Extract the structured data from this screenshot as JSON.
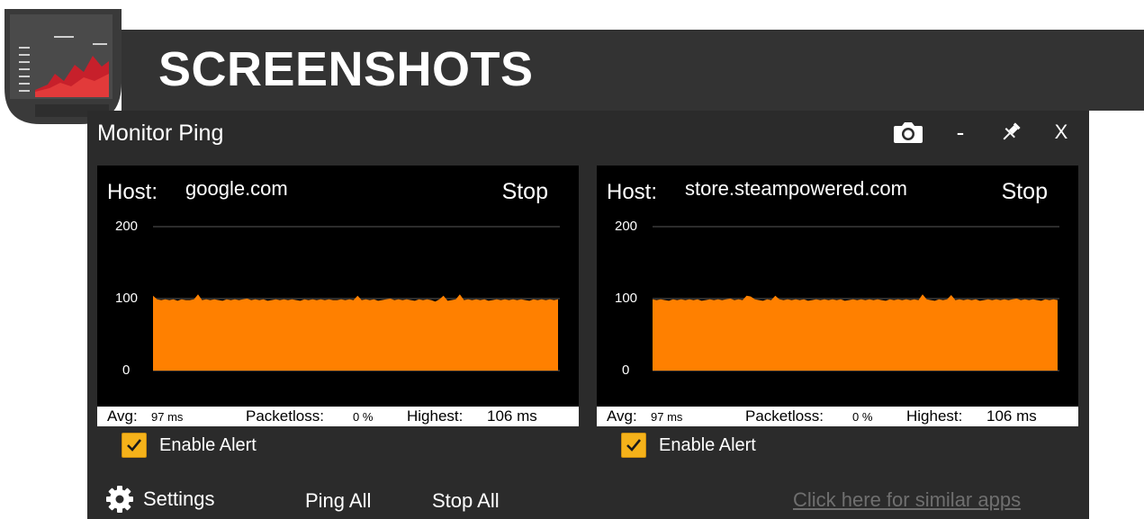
{
  "banner": {
    "title": "SCREENSHOTS",
    "logo_icon": "chart-logo-icon"
  },
  "window": {
    "title": "Monitor Ping",
    "buttons": {
      "screenshot_icon": "camera-icon",
      "minimize": "-",
      "pin_icon": "pin-icon",
      "close": "X"
    }
  },
  "panels": [
    {
      "host_label": "Host:",
      "host": "google.com",
      "stop": "Stop",
      "y_ticks": [
        "200",
        "100",
        "0"
      ],
      "avg_label": "Avg:",
      "avg": "97 ms",
      "loss_label": "Packetloss:",
      "loss": "0 %",
      "high_label": "Highest:",
      "high": "106 ms",
      "alert_label": "Enable Alert",
      "alert_checked": true
    },
    {
      "host_label": "Host:",
      "host": "store.steampowered.com",
      "stop": "Stop",
      "y_ticks": [
        "200",
        "100",
        "0"
      ],
      "avg_label": "Avg:",
      "avg": "97 ms",
      "loss_label": "Packetloss:",
      "loss": "0 %",
      "high_label": "Highest:",
      "high": "106 ms",
      "alert_label": "Enable Alert",
      "alert_checked": true
    }
  ],
  "chart_data": [
    {
      "type": "area",
      "title": "",
      "ylim": [
        0,
        200
      ],
      "y_ticks": [
        0,
        100,
        200
      ],
      "color": "#ff8000",
      "values": [
        104,
        99,
        98,
        99,
        98,
        99,
        97,
        99,
        98,
        98,
        99,
        106,
        98,
        99,
        98,
        99,
        98,
        97,
        99,
        98,
        99,
        98,
        99,
        100,
        98,
        99,
        98,
        99,
        97,
        98,
        99,
        98,
        99,
        98,
        99,
        98,
        97,
        99,
        98,
        99,
        98,
        99,
        98,
        99,
        98,
        98,
        99,
        98,
        99,
        98,
        104,
        98,
        99,
        98,
        99,
        97,
        98,
        99,
        100,
        98,
        99,
        98,
        99,
        98,
        97,
        99,
        98,
        99,
        98,
        96,
        99,
        104,
        97,
        98,
        99,
        106,
        98,
        99,
        98,
        99,
        98,
        99,
        97,
        98,
        99,
        98,
        99,
        98,
        99,
        98,
        99,
        98,
        97,
        99,
        98,
        99,
        98,
        99,
        98,
        99
      ]
    },
    {
      "type": "area",
      "title": "",
      "ylim": [
        0,
        200
      ],
      "y_ticks": [
        0,
        100,
        200
      ],
      "color": "#ff8000",
      "values": [
        99,
        98,
        99,
        98,
        97,
        99,
        98,
        99,
        98,
        99,
        98,
        99,
        97,
        98,
        99,
        98,
        99,
        98,
        99,
        100,
        98,
        99,
        98,
        104,
        103,
        99,
        98,
        97,
        99,
        98,
        104,
        99,
        98,
        99,
        98,
        99,
        98,
        99,
        97,
        98,
        99,
        98,
        99,
        98,
        99,
        98,
        99,
        97,
        98,
        99,
        98,
        99,
        98,
        99,
        98,
        99,
        98,
        97,
        99,
        98,
        99,
        98,
        99,
        98,
        99,
        98,
        106,
        99,
        98,
        97,
        99,
        98,
        99,
        105,
        98,
        99,
        98,
        99,
        98,
        99,
        97,
        98,
        99,
        98,
        99,
        98,
        99,
        98,
        99,
        100,
        98,
        99,
        98,
        99,
        98,
        97,
        99,
        98,
        99,
        98
      ]
    }
  ],
  "footer": {
    "settings": "Settings",
    "settings_icon": "gear-icon",
    "ping_all": "Ping All",
    "stop_all": "Stop All",
    "similar_apps": "Click here for similar apps"
  },
  "colors": {
    "accent": "#ff8000",
    "window_bg": "#2b2b2b",
    "banner_bg": "#333333",
    "checkbox": "#f5b21a"
  }
}
